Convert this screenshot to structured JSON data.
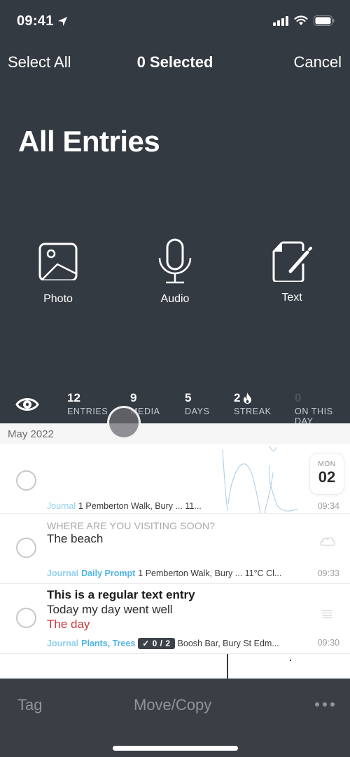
{
  "status_bar": {
    "time": "09:41",
    "icons": [
      "location-arrow-icon",
      "cellular-signal-icon",
      "wifi-icon",
      "battery-icon"
    ]
  },
  "nav": {
    "left_label": "Select All",
    "title": "0 Selected",
    "right_label": "Cancel"
  },
  "page_title": "All Entries",
  "quick_actions": [
    {
      "label": "Photo",
      "icon": "photo-icon"
    },
    {
      "label": "Audio",
      "icon": "microphone-icon"
    },
    {
      "label": "Text",
      "icon": "text-document-edit-icon"
    }
  ],
  "stats": {
    "visibility_icon": "eye-icon",
    "items": [
      {
        "value": "12",
        "label": "ENTRIES"
      },
      {
        "value": "9",
        "label": "MEDIA"
      },
      {
        "value": "5",
        "label": "DAYS"
      },
      {
        "value": "2",
        "label": "STREAK",
        "icon": "flame-icon"
      },
      {
        "value": "0",
        "label": "ON THIS DAY"
      }
    ]
  },
  "list": {
    "section_header": "May 2022",
    "entries": [
      {
        "type": "drawing",
        "journal": "Journal",
        "meta": "1 Pemberton Walk, Bury ... 11...",
        "time": "09:34",
        "date_badge": {
          "dow": "MON",
          "day": "02"
        }
      },
      {
        "type": "prompt",
        "prompt": "WHERE ARE YOU VISITING SOON?",
        "body": "The beach",
        "journal": "Journal",
        "tags": "Daily Prompt",
        "meta": "1 Pemberton Walk, Bury ... 11°C Cl...",
        "time": "09:33",
        "icon": "cloud-icon"
      },
      {
        "type": "text",
        "title": "This is a regular text entry",
        "line2": "Today my day went well",
        "line3": "The day",
        "journal": "Journal",
        "tags": "Plants, Trees",
        "checklist": "✓ 0 / 2",
        "meta": "Boosh Bar, Bury St Edm...",
        "time": "09:30",
        "icon": "text-lines-icon"
      }
    ]
  },
  "toolbar": {
    "tag_label": "Tag",
    "move_label": "Move/Copy",
    "more_icon": "more-horizontal-icon"
  },
  "colors": {
    "header_bg": "#343a42",
    "journal_tag": "#8fd1ef",
    "tag_blue": "#4fb3e6",
    "highlight_red": "#d2363f",
    "toolbar_bg": "#3a3f46"
  }
}
